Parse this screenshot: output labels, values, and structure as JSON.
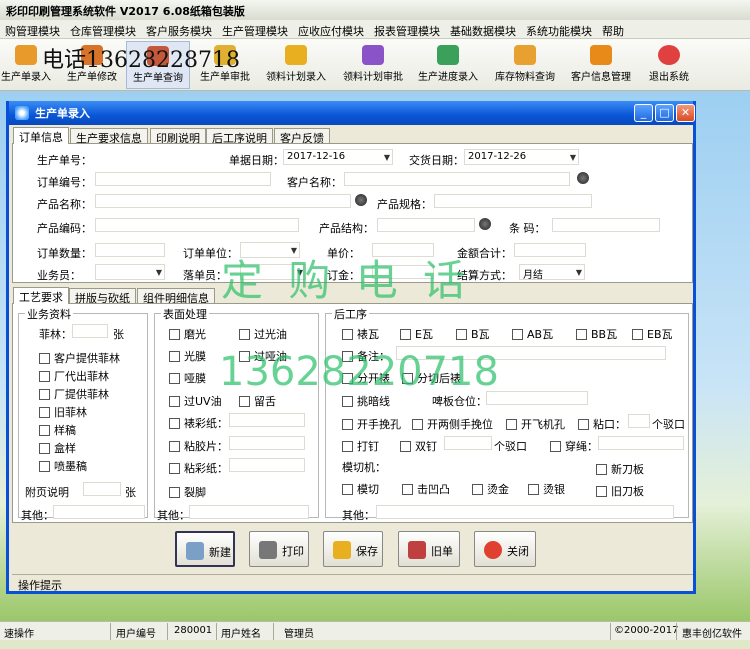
{
  "app": {
    "title": "彩印印刷管理系统软件  V2017 6.08纸箱包装版"
  },
  "menu": [
    "购管理模块",
    "仓库管理模块",
    "客户服务模块",
    "生产管理模块",
    "应收应付模块",
    "报表管理模块",
    "基础数据模块",
    "系统功能模块",
    "帮助"
  ],
  "toolbar": {
    "phone_overlay": "电话13628228718",
    "items": [
      {
        "label": "生产单录入",
        "icon": "box-icon",
        "color": "#e89a2a"
      },
      {
        "label": "生产单修改",
        "icon": "box-edit-icon",
        "color": "#d8742a"
      },
      {
        "label": "生产单查询",
        "icon": "search-box-icon",
        "color": "#c4583a"
      },
      {
        "label": "生产单审批",
        "icon": "approve-icon",
        "color": "#e0b030"
      },
      {
        "label": "领料计划录入",
        "icon": "material-plan-icon",
        "color": "#e8b020"
      },
      {
        "label": "领料计划审批",
        "icon": "plan-approve-icon",
        "color": "#8a54c8"
      },
      {
        "label": "生产进度录入",
        "icon": "progress-icon",
        "color": "#3aa05a"
      },
      {
        "label": "库存物料查询",
        "icon": "stock-icon",
        "color": "#e8a030"
      },
      {
        "label": "客户信息管理",
        "icon": "customer-icon",
        "color": "#e88a1a"
      },
      {
        "label": "退出系统",
        "icon": "exit-icon",
        "color": "#e04040"
      }
    ]
  },
  "window": {
    "title": "生产单录入",
    "tabs": [
      "订单信息",
      "生产要求信息",
      "印刷说明",
      "后工序说明",
      "客户反馈"
    ],
    "form": {
      "order_no_label": "生产单号：",
      "date_label": "单据日期：",
      "date_value": "2017-12-16",
      "delivery_label": "交货日期：",
      "delivery_value": "2017-12-26",
      "order_code_label": "订单编号：",
      "customer_label": "客户名称：",
      "product_name_label": "产品名称：",
      "product_spec_label": "产品规格：",
      "product_code_label": "产品编码：",
      "product_struct_label": "产品结构：",
      "barcode_label": "条  码：",
      "qty_label": "订单数量：",
      "unit_label": "订单单位：",
      "price_label": "单价：",
      "amount_label": "金额合计：",
      "salesman_label": "业务员：",
      "clerk_label": "落单员：",
      "deposit_label": "订金：",
      "settle_label": "结算方式：",
      "settle_value": "月结"
    },
    "subtabs": [
      "工艺要求",
      "拼版与砍纸",
      "组件明细信息"
    ],
    "business": {
      "title": "业务资料",
      "film_label": "菲林：",
      "film_unit": "张",
      "checks": [
        "客户提供菲林",
        "厂代出菲林",
        "厂提供菲林",
        "旧菲林",
        "样稿",
        "盒样",
        "喷墨稿"
      ],
      "attach_label": "附页说明",
      "attach_unit": "张",
      "other_label": "其他："
    },
    "surface": {
      "title": "表面处理",
      "left_checks": [
        "磨光",
        "光膜",
        "哑膜",
        "过UV油",
        "裱彩纸：",
        "粘胶片：",
        "粘彩纸：",
        "裂脚"
      ],
      "right_checks": [
        "过光油",
        "过哑油",
        "留舌"
      ],
      "other_label": "其他："
    },
    "post": {
      "title": "后工序",
      "row1": [
        "裱瓦",
        "E瓦",
        "B瓦",
        "AB瓦",
        "BB瓦",
        "EB瓦"
      ],
      "note_label": "备注：",
      "split_a": "分开裱",
      "split_b": "分切后裱",
      "line_label": "挑暗线",
      "position_label": "啤板仓位：",
      "row4": [
        "开手挽孔",
        "开两侧手挽位",
        "开飞机孔",
        "粘口："
      ],
      "row4_unit": "个驳口",
      "row5": [
        "打钉",
        "双钉"
      ],
      "row5_unit": "个驳口",
      "wear_label": "穿绳：",
      "die_label": "模切机：",
      "new_die": "新刀板",
      "row7": [
        "模切",
        "击凹凸",
        "烫金",
        "烫银"
      ],
      "old_die": "旧刀板",
      "other_label": "其他："
    },
    "buttons": [
      {
        "label": "新建",
        "icon": "new-icon",
        "color": "#7aa0c8"
      },
      {
        "label": "打印",
        "icon": "printer-icon",
        "color": "#777"
      },
      {
        "label": "保存",
        "icon": "save-icon",
        "color": "#e8b020"
      },
      {
        "label": "旧单",
        "icon": "old-order-icon",
        "color": "#c04040"
      },
      {
        "label": "关闭",
        "icon": "close-icon",
        "color": "#e04030"
      }
    ],
    "hint": "操作提示",
    "watermark_text": "定 购 电 话",
    "watermark_number": "13628220718"
  },
  "status": {
    "user": "速操作",
    "user_no_label": "用户编号",
    "user_no": "280001",
    "user_name_label": "用户姓名",
    "user_name": "管理员",
    "copyright": "©2000-2017",
    "vendor": "惠丰创亿软件"
  }
}
